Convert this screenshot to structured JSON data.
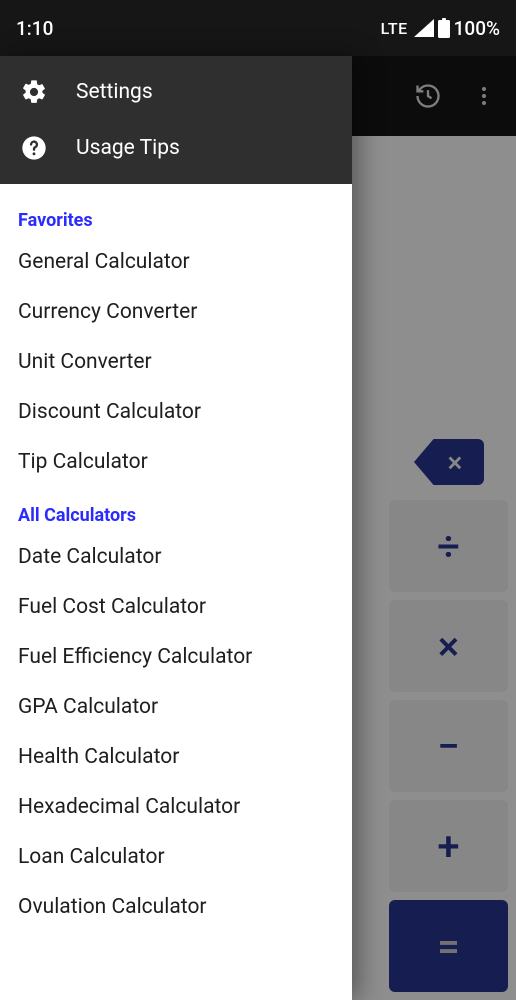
{
  "statusBar": {
    "time": "1:10",
    "network": "LTE",
    "battery": "100%"
  },
  "appBar": {},
  "drawer": {
    "header": [
      {
        "label": "Settings",
        "icon": "gear"
      },
      {
        "label": "Usage Tips",
        "icon": "question"
      }
    ],
    "sections": [
      {
        "title": "Favorites",
        "items": [
          "General Calculator",
          "Currency Converter",
          "Unit Converter",
          "Discount Calculator",
          "Tip Calculator"
        ]
      },
      {
        "title": "All Calculators",
        "items": [
          "Date Calculator",
          "Fuel Cost Calculator",
          "Fuel Efficiency Calculator",
          "GPA Calculator",
          "Health Calculator",
          "Hexadecimal Calculator",
          "Loan Calculator",
          "Ovulation Calculator"
        ]
      }
    ]
  },
  "keypad": {
    "backspace": "×",
    "ops": [
      "÷",
      "×",
      "−",
      "+",
      "="
    ]
  }
}
